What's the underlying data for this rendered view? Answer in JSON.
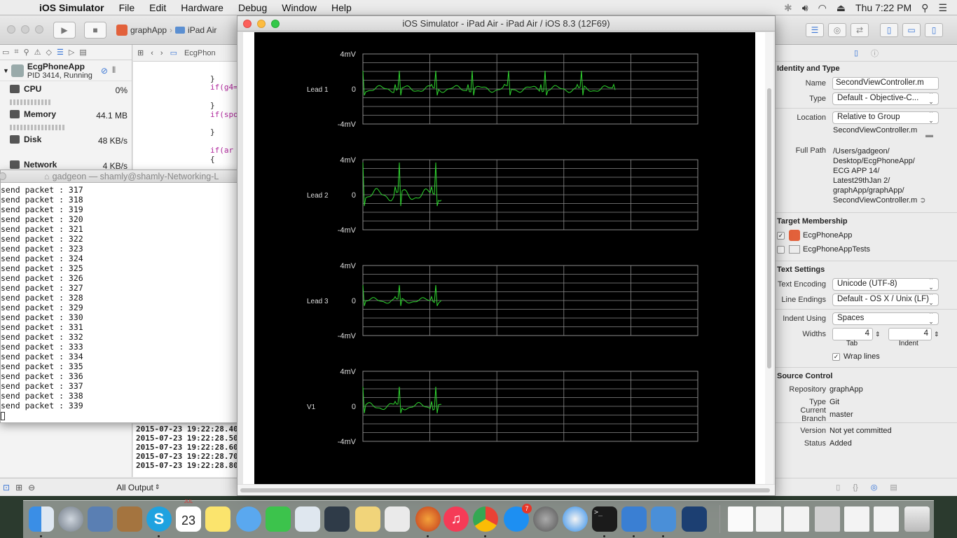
{
  "menubar": {
    "app_name": "iOS Simulator",
    "items": [
      "File",
      "Edit",
      "Hardware",
      "Debug",
      "Window",
      "Help"
    ],
    "clock": "Thu 7:22 PM"
  },
  "xcode": {
    "scheme_app": "graphApp",
    "scheme_device": "iPad Air",
    "editor_tab": "EcgPhon",
    "process": {
      "name": "EcgPhoneApp",
      "status": "PID 3414, Running"
    },
    "gauges": [
      {
        "name": "CPU",
        "value": "0%"
      },
      {
        "name": "Memory",
        "value": "44.1 MB"
      },
      {
        "name": "Disk",
        "value": "48 KB/s"
      },
      {
        "name": "Network",
        "value": "4 KB/s"
      }
    ],
    "code_lines": [
      "}",
      "if(g4=",
      "}",
      "if(spo",
      "}",
      "",
      "if(ar",
      "{"
    ],
    "console_lines": [
      "2015-07-23 19:22:28.40",
      "2015-07-23 19:22:28.50",
      "2015-07-23 19:22:28.60",
      "2015-07-23 19:22:28.70",
      "2015-07-23 19:22:28.80"
    ],
    "console_filter": "All Output"
  },
  "terminal": {
    "title": "gadgeon — shamly@shamly-Networking-L",
    "lines": [
      "send packet : 317",
      "send packet : 318",
      "send packet : 319",
      "send packet : 320",
      "send packet : 321",
      "send packet : 322",
      "send packet : 323",
      "send packet : 324",
      "send packet : 325",
      "send packet : 326",
      "send packet : 327",
      "send packet : 328",
      "send packet : 329",
      "send packet : 330",
      "send packet : 331",
      "send packet : 332",
      "send packet : 333",
      "send packet : 334",
      "send packet : 335",
      "send packet : 336",
      "send packet : 337",
      "send packet : 338",
      "send packet : 339"
    ]
  },
  "simulator": {
    "title": "iOS Simulator - iPad Air - iPad Air / iOS 8.3 (12F69)",
    "leads": [
      {
        "label": "Lead 1",
        "top": "4mV",
        "mid": "0",
        "bottom": "-4mV"
      },
      {
        "label": "Lead 2",
        "top": "4mV",
        "mid": "0",
        "bottom": "-4mV"
      },
      {
        "label": "Lead 3",
        "top": "4mV",
        "mid": "0",
        "bottom": "-4mV"
      },
      {
        "label": "V1",
        "top": "4mV",
        "mid": "0",
        "bottom": "-4mV"
      }
    ],
    "trace_color": "#2fd52f",
    "grid_color": "#8a8a8a"
  },
  "inspector": {
    "identity_title": "Identity and Type",
    "name_label": "Name",
    "name_value": "SecondViewController.m",
    "type_label": "Type",
    "type_value": "Default - Objective-C...",
    "location_label": "Location",
    "location_value": "Relative to Group",
    "location_file": "SecondViewController.m",
    "fullpath_label": "Full Path",
    "fullpath_lines": [
      "/Users/gadgeon/",
      "Desktop/EcgPhoneApp/",
      "ECG APP 14/",
      "Latest29thJan 2/",
      "graphApp/graphApp/",
      "SecondViewController.m"
    ],
    "target_title": "Target Membership",
    "targets": [
      {
        "name": "EcgPhoneApp",
        "checked": "✓"
      },
      {
        "name": "EcgPhoneAppTests",
        "checked": ""
      }
    ],
    "text_title": "Text Settings",
    "encoding_label": "Text Encoding",
    "encoding_value": "Unicode (UTF-8)",
    "endings_label": "Line Endings",
    "endings_value": "Default - OS X / Unix (LF)",
    "indent_label": "Indent Using",
    "indent_value": "Spaces",
    "widths_label": "Widths",
    "tab_value": "4",
    "indent_width_value": "4",
    "tab_label": "Tab",
    "indent_sub_label": "Indent",
    "wrap_label": "Wrap lines",
    "source_title": "Source Control",
    "repo_label": "Repository",
    "repo_value": "graphApp",
    "sctype_label": "Type",
    "sctype_value": "Git",
    "branch_label": "Current Branch",
    "branch_value": "master",
    "version_label": "Version",
    "version_value": "Not yet committed",
    "status_label": "Status",
    "status_value": "Added"
  },
  "dock": {
    "calendar_day": "23",
    "calendar_month": "JUL",
    "appstore_badge": "7"
  }
}
